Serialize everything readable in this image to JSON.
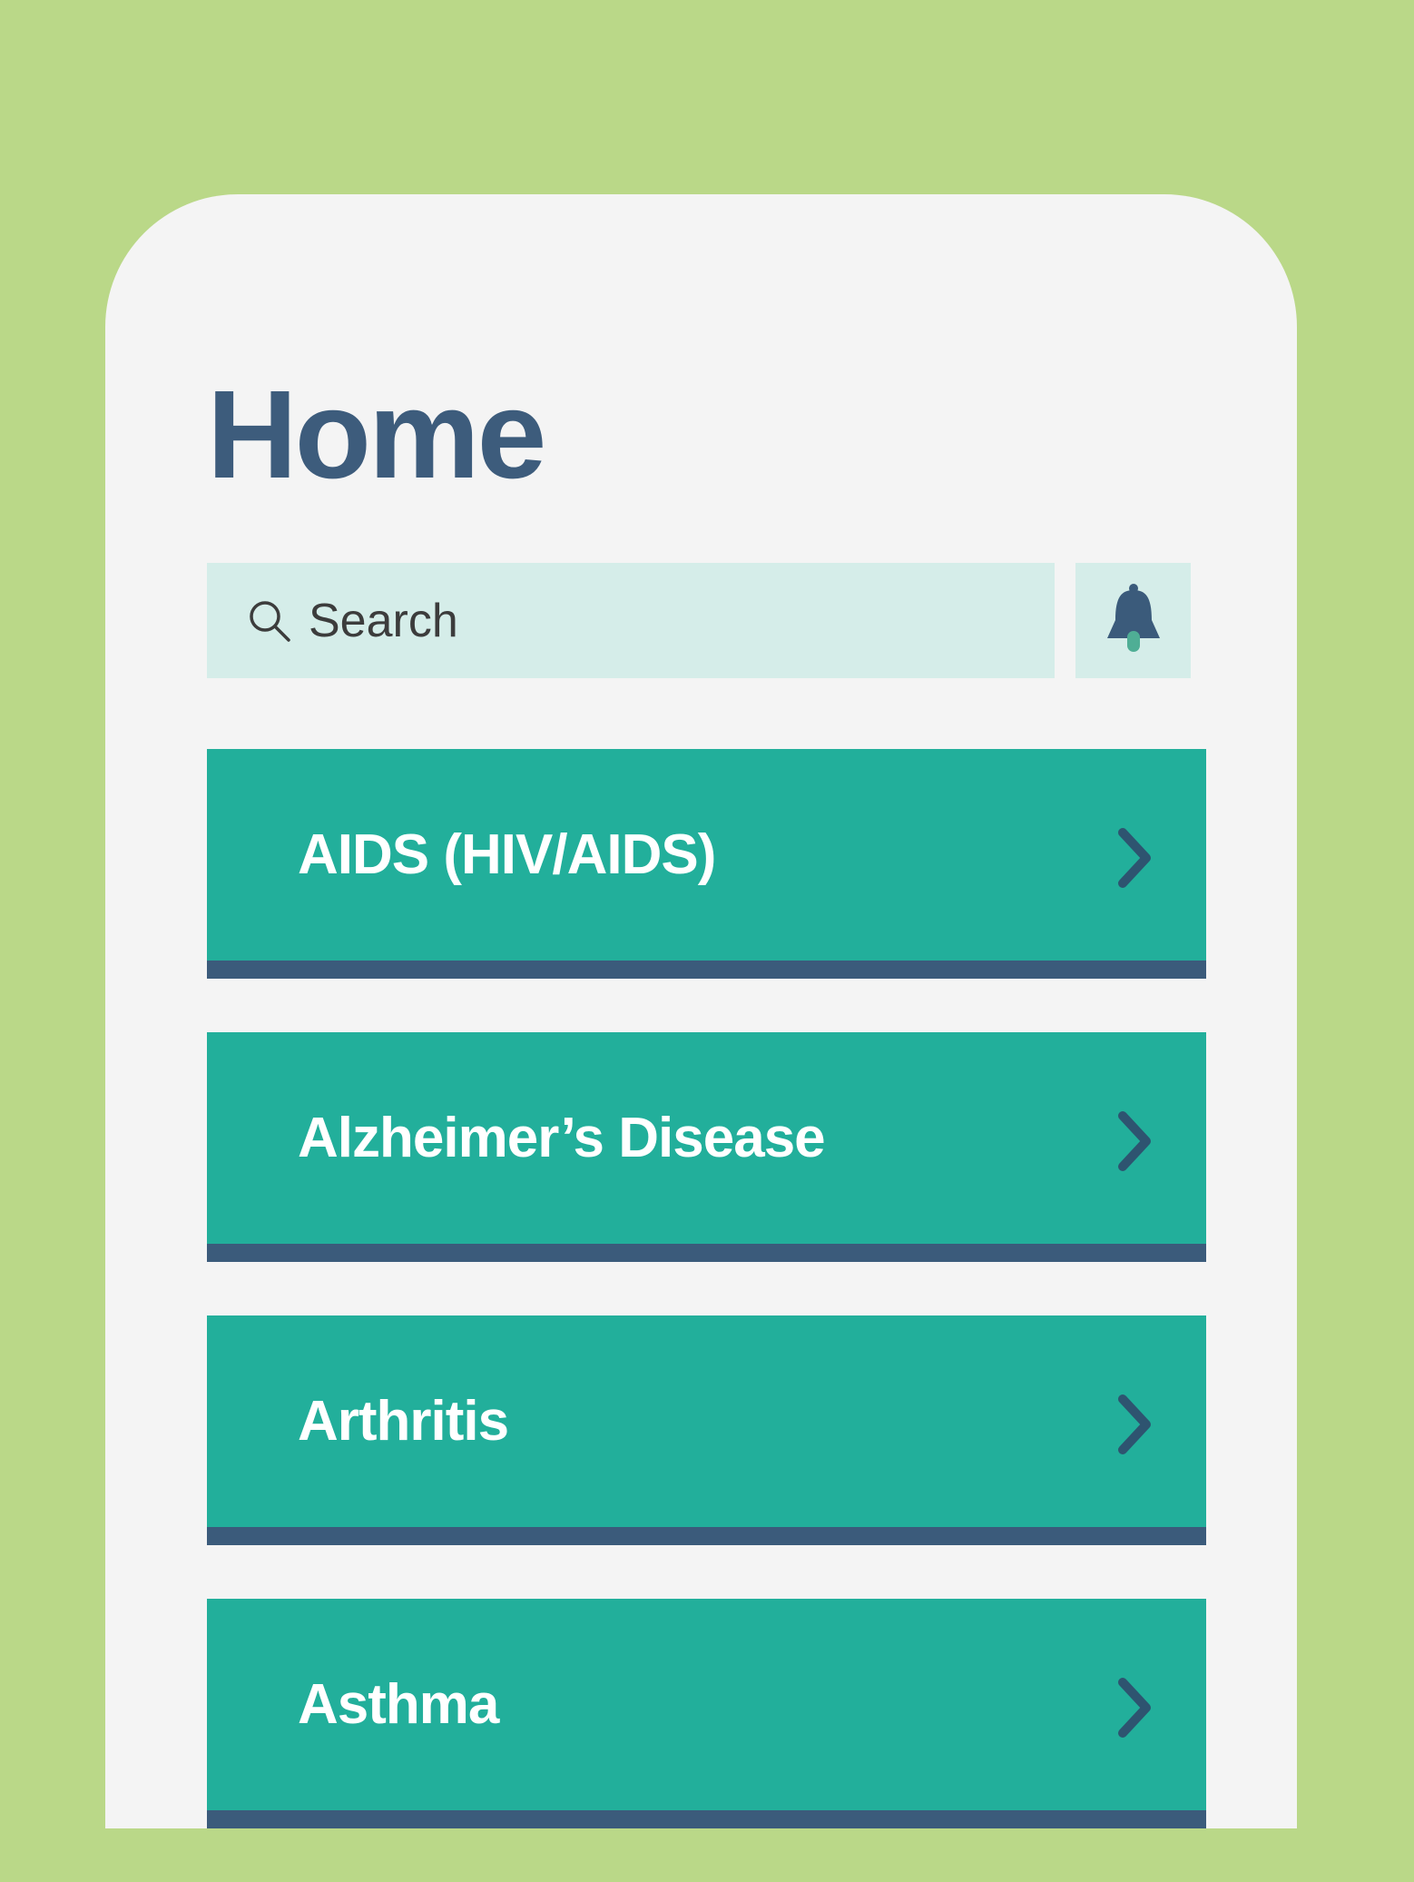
{
  "screen": {
    "title": "Home"
  },
  "search": {
    "placeholder": "Search",
    "icon": "search-icon"
  },
  "notifications": {
    "icon": "bell-icon"
  },
  "conditions": [
    {
      "label": "AIDS (HIV/AIDS)",
      "icon": "chevron-right-icon"
    },
    {
      "label": "Alzheimer’s Disease",
      "icon": "chevron-right-icon"
    },
    {
      "label": "Arthritis",
      "icon": "chevron-right-icon"
    },
    {
      "label": "Asthma",
      "icon": "chevron-right-icon"
    }
  ],
  "colors": {
    "background": "#bad888",
    "screen": "#f4f4f4",
    "title": "#3d5c7c",
    "search_bg": "#d5ede9",
    "item_bg": "#22af9b",
    "item_border": "#3b5b7b",
    "item_text": "#ffffff",
    "bell_clapper": "#4fae95"
  }
}
